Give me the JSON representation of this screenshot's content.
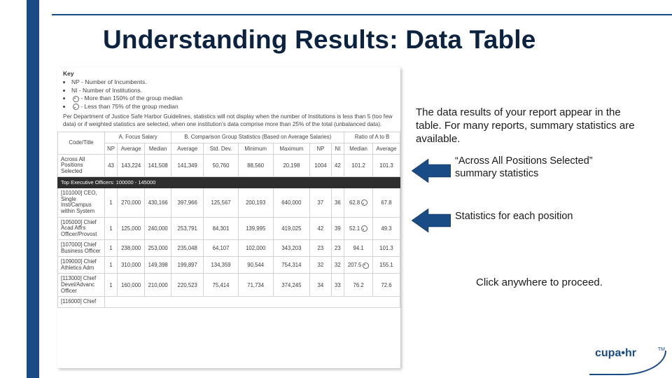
{
  "slide": {
    "title": "Understanding Results: Data Table"
  },
  "key": {
    "heading": "Key",
    "items": [
      "NP - Number of Incumbents.",
      "NI - Number of Institutions.",
      " - More than 150% of the group median",
      " - Less than 75% of the group median"
    ]
  },
  "guideline": "Per Department of Justice Safe Harbor Guidelines, statistics will not display when the number of Institutions is less than 5 (too few data) or if weighted statistics are selected, when one institution's data comprise more than 25% of the total (unbalanced data).",
  "headers": {
    "code": "Code/Title",
    "groupA": "A. Focus Salary",
    "groupB": "B. Comparison Group Statistics (Based on Average Salaries)",
    "ratio": "Ratio of A to B",
    "c_np": "NP",
    "c_avg": "Average",
    "c_med": "Median",
    "c_avg2": "Average",
    "c_std": "Std. Dev.",
    "c_min": "Minimum",
    "c_max": "Maximum",
    "c_np2": "NP",
    "c_ni": "NI",
    "c_med2": "Median",
    "c_avg3": "Average"
  },
  "section_band": "Top Executive Officers: 100000 - 145000",
  "rows": [
    {
      "label": "Across All Positions Selected",
      "np": "43",
      "avg": "143,224",
      "med": "141,508",
      "avg2": "141,349",
      "std": "50,760",
      "min": "88,560",
      "max": "20,198",
      "np2": "1004",
      "ni": "42",
      "rmed": "101.2",
      "ravg": "101.3"
    },
    {
      "label": "[101000] CEO, Single Inst/Campus within System",
      "np": "1",
      "avg": "270,000",
      "med": "430,166",
      "avg2": "397,966",
      "std": "125,567",
      "min": "200,193",
      "max": "640,000",
      "np2": "37",
      "ni": "36",
      "rmed": "62.8",
      "ravg": "67.8"
    },
    {
      "label": "[105000] Chief Acad Affrs Officer/Provost",
      "np": "1",
      "avg": "125,000",
      "med": "240,000",
      "avg2": "253,791",
      "std": "84,301",
      "min": "139,995",
      "max": "419,025",
      "np2": "42",
      "ni": "39",
      "rmed": "52.1",
      "ravg": "49.3"
    },
    {
      "label": "[107000] Chief Business Officer",
      "np": "1",
      "avg": "238,000",
      "med": "253,000",
      "avg2": "235,048",
      "std": "64,107",
      "min": "102,000",
      "max": "343,203",
      "np2": "23",
      "ni": "23",
      "rmed": "94.1",
      "ravg": "101.3"
    },
    {
      "label": "[109000] Chief Athletics Adm",
      "np": "1",
      "avg": "310,000",
      "med": "149,398",
      "avg2": "199,897",
      "std": "134,359",
      "min": "90,544",
      "max": "754,314",
      "np2": "32",
      "ni": "32",
      "rmed": "207.5",
      "ravg": "155.1"
    },
    {
      "label": "[113000] Chief Devel/Advanc Officer",
      "np": "1",
      "avg": "160,000",
      "med": "210,000",
      "avg2": "220,523",
      "std": "75,414",
      "min": "71,734",
      "max": "374,245",
      "np2": "34",
      "ni": "33",
      "rmed": "76.2",
      "ravg": "72.6"
    }
  ],
  "partial_row_label": "[116000] Chief",
  "side": {
    "intro": "The data results of your report appear in the table. For many reports, summary statistics are available.",
    "callout1": "“Across All Positions Selected” summary statistics",
    "callout2": "Statistics for each position",
    "proceed": "Click anywhere to proceed."
  },
  "logo": {
    "text": "cupa•hr",
    "tm": "TM"
  }
}
